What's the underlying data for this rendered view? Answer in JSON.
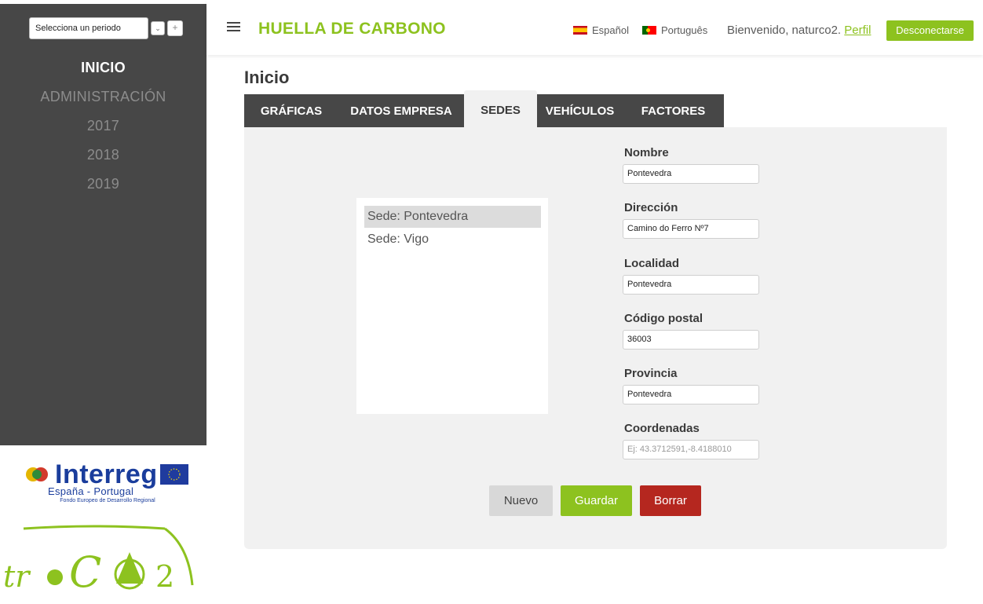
{
  "sidebar": {
    "period_select": "Selecciona un periodo",
    "period_caret": "⌄",
    "period_add": "+",
    "nav": [
      "INICIO",
      "ADMINISTRACIÓN",
      "2017",
      "2018",
      "2019"
    ],
    "interreg": {
      "word": "Interreg",
      "subtitle": "España - Portugal",
      "fund": "Fondo Europeo de Desarrollo Regional"
    },
    "troco2": "troCO2"
  },
  "header": {
    "title": "HUELLA DE CARBONO",
    "languages": [
      {
        "label": "Español",
        "flag": "flag-es-icon"
      },
      {
        "label": "Português",
        "flag": "flag-pt-icon"
      }
    ],
    "welcome": "Bienvenido, naturco2.",
    "profile_link": "Perfil",
    "logout": "Desconectarse"
  },
  "main": {
    "page_title": "Inicio",
    "tabs": [
      "GRÁFICAS",
      "DATOS EMPRESA",
      "SEDES",
      "VEHÍCULOS",
      "FACTORES"
    ],
    "active_tab": "SEDES",
    "sedes": [
      "Sede: Pontevedra",
      "Sede: Vigo"
    ],
    "selected_sede": "Sede: Pontevedra",
    "form": {
      "nombre": {
        "label": "Nombre",
        "value": "Pontevedra"
      },
      "direccion": {
        "label": "Dirección",
        "value": "Camino do Ferro Nº7"
      },
      "localidad": {
        "label": "Localidad",
        "value": "Pontevedra"
      },
      "codigo_postal": {
        "label": "Código postal",
        "value": "36003"
      },
      "provincia": {
        "label": "Provincia",
        "value": "Pontevedra"
      },
      "coordenadas": {
        "label": "Coordenadas",
        "value": "",
        "placeholder": "Ej: 43.3712591,-8.4188010"
      }
    },
    "buttons": {
      "new": "Nuevo",
      "save": "Guardar",
      "delete": "Borrar"
    }
  },
  "colors": {
    "accent": "#8dc21f",
    "sidebar_bg": "#474747",
    "danger": "#b5271f",
    "panel_bg": "#f1f1f1"
  }
}
